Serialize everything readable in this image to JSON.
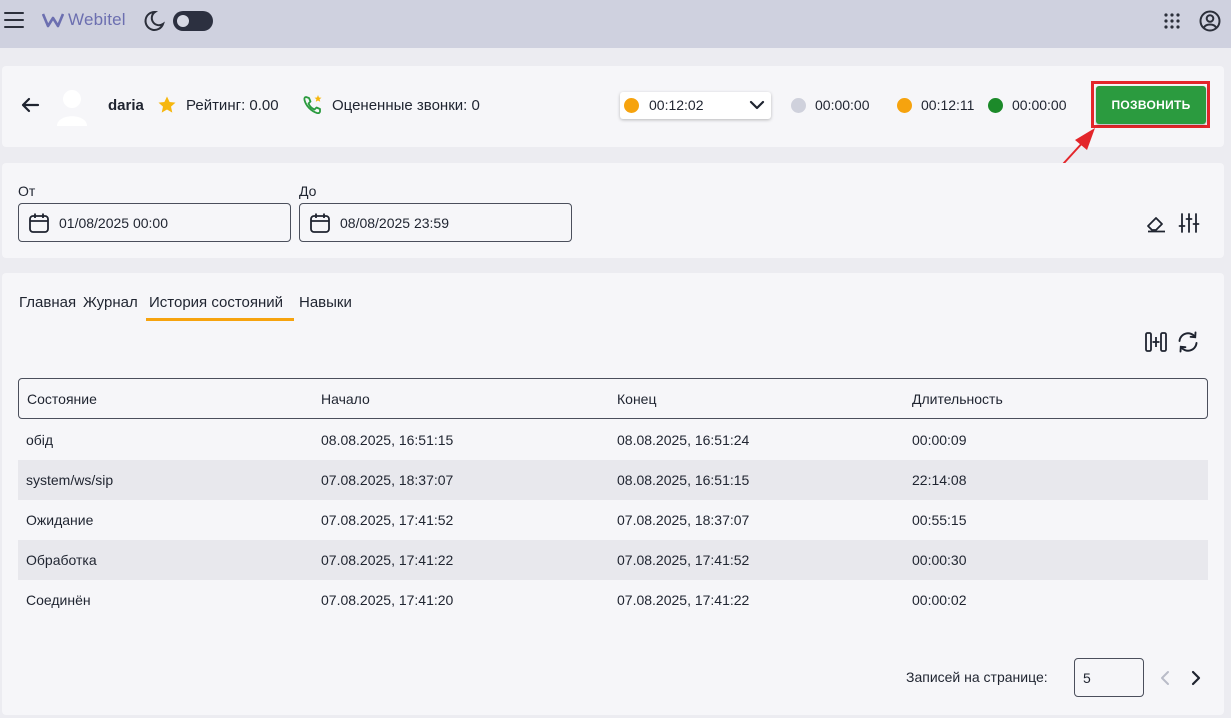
{
  "app": {
    "logo_text": "Webitel"
  },
  "agent": {
    "name": "daria",
    "rating": "Рейтинг: 0.00",
    "rated_calls": "Оцененные звонки: 0"
  },
  "status": {
    "selected_time": "00:12:02",
    "selected_color": "#f6a30e",
    "timers": [
      {
        "color": "#cfd1dc",
        "value": "00:00:00"
      },
      {
        "color": "#f6a30e",
        "value": "00:12:11"
      },
      {
        "color": "#1c8a2a",
        "value": "00:00:00"
      }
    ]
  },
  "call_button": "ПОЗВОНИТЬ",
  "filters": {
    "from_label": "От",
    "from_value": "01/08/2025 00:00",
    "to_label": "До",
    "to_value": "08/08/2025 23:59"
  },
  "tabs": [
    "Главная",
    "Журнал",
    "История состояний",
    "Навыки"
  ],
  "table": {
    "headers": [
      "Состояние",
      "Начало",
      "Конец",
      "Длительность"
    ],
    "rows": [
      [
        "обід",
        "08.08.2025, 16:51:15",
        "08.08.2025, 16:51:24",
        "00:00:09"
      ],
      [
        "system/ws/sip",
        "07.08.2025, 18:37:07",
        "08.08.2025, 16:51:15",
        "22:14:08"
      ],
      [
        "Ожидание",
        "07.08.2025, 17:41:52",
        "07.08.2025, 18:37:07",
        "00:55:15"
      ],
      [
        "Обработка",
        "07.08.2025, 17:41:22",
        "07.08.2025, 17:41:52",
        "00:00:30"
      ],
      [
        "Соединён",
        "07.08.2025, 17:41:20",
        "07.08.2025, 17:41:22",
        "00:00:02"
      ]
    ]
  },
  "pagination": {
    "label": "Записей на странице:",
    "value": "5"
  }
}
